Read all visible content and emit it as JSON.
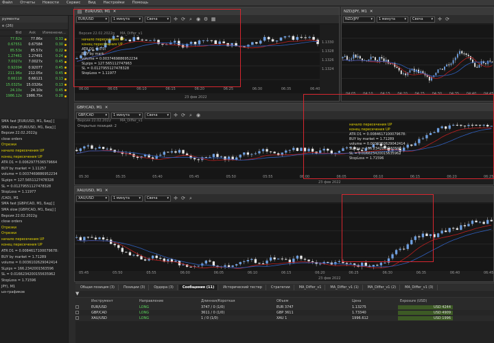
{
  "menu": [
    "Файл",
    "Отчеты",
    "Новости",
    "Сервис",
    "Вид",
    "Настройки",
    "Помощь"
  ],
  "left": {
    "label": "рументы",
    "tabs": [
      "е (26)",
      ""
    ],
    "cols": [
      "",
      "Bid",
      "Ask",
      "Изменени..."
    ],
    "quotes": [
      [
        "77.82x",
        "77.86x",
        "0.33"
      ],
      [
        "0.67551",
        "0.67584",
        "0.30"
      ],
      [
        "85.53x",
        "85.57x",
        "0.22"
      ],
      [
        "1.27461",
        "1.27491",
        "0.24"
      ],
      [
        "7.0027x",
        "7.0027x",
        "0.45"
      ],
      [
        "0.92094",
        "0.92077",
        "0.45"
      ],
      [
        "211.96x",
        "212.05x",
        "0.45"
      ],
      [
        "0.66118",
        "0.66121",
        "0.13"
      ],
      [
        "15.0325x",
        "15.0326x",
        "0.13"
      ],
      [
        "24.10x",
        "24.10x",
        "0.45"
      ],
      [
        "1986.12x",
        "1986.75x",
        "0.28"
      ]
    ],
    "log": [
      "SMA fast [EUR/USD, M1, Бид] [",
      "SMA slow [EUR/USD, M1, Бид] [",
      "Версия 22.02.2022g",
      "close orders",
      "Отрезки",
      "начало пересечения UP",
      "конец пересечения UP",
      "ATR D1 = 0.0062977536579664",
      "BUY by market = 1.11257",
      "volume = 0.0037469886952234",
      "SLpips = 127.5651127478328",
      "SL = 0.01279551127478328",
      "StopLoss = 1.11977",
      "/CAD), M1",
      "SMA fast [GBP/CAD, M1, Бид] [",
      "SMA slow [GBP/CAD, M1, Бид] [",
      "Версия 22.02.2022g",
      "close orders",
      "Отрезки",
      "Отрезки",
      "начало пересечения UP",
      "конец пересечения UP",
      "ATR D1 = 0.0084617100079678:",
      "BUY by market = 1.71289",
      "volume = 0.0036102629042414",
      "SLpips = 166.2342001563596",
      "SL = 0.0166234200155635962",
      "StopLoss = 1.71596",
      "JPY), M1",
      "ыэ-графиков"
    ]
  },
  "windows": [
    {
      "title": "EUR/USD, M1",
      "symbol": "EUR/USD",
      "tf": "1 минута",
      "ctype": "Свеча",
      "axis": [
        "1.1330",
        "1.1328",
        "1.1326",
        "1.1324"
      ],
      "times": [
        "06:00",
        "06:05",
        "06:10",
        "06:15",
        "06:20",
        "06:25",
        "06:30",
        "06:35",
        "06:40"
      ],
      "date": "23 фев 2022",
      "version": "Версия 22.02.2022g",
      "ma": "MA_Differ_v1",
      "ann": [
        "начало пересечения UP",
        "конец пересечения UP",
        "ATR D1 = 0.0",
        "BUY by mark",
        "volume = 0.0037469886952234",
        "SLpips = 127.565112747963",
        "SL = 0.0127955127478328",
        "StopLoss = 1.11977"
      ]
    },
    {
      "title": "NZD/JPY, M1",
      "symbol": "NZD/JPY",
      "tf": "1 минута",
      "ctype": "Свеча",
      "times": [
        "04:05",
        "04:10",
        "04:15",
        "04:20",
        "04:25",
        "04:30",
        "04:35",
        "04:40",
        "04:45"
      ]
    },
    {
      "title": "GBP/CAD, M1",
      "symbol": "GBP/CAD",
      "tf": "1 минута",
      "ctype": "Свеча",
      "times": [
        "05:30",
        "05:35",
        "05:40",
        "05:45",
        "05:50",
        "05:55",
        "06:00",
        "06:05",
        "06:10",
        "06:15",
        "06:20",
        "06:25"
      ],
      "date": "23 фев 2022",
      "version": "Версия 22.02.2022",
      "open": "Открытых позиций: 2",
      "ma": "MA_Differ_v1",
      "ann": [
        "начало пересечения UP",
        "конец пересечения UP",
        "ATR D1 = 0.0084617100079678:",
        "BUY by market = 1.71289",
        "volume = 0.0036102629042414",
        "SLpips = 166.2342001563596",
        "SL = 0.016623420015635962",
        "StopLoss = 1.71596"
      ]
    },
    {
      "title": "XAU/USD, M1",
      "symbol": "XAU/USD",
      "tf": "1 минута",
      "ctype": "Свеча",
      "times": [
        "05:45",
        "05:50",
        "05:55",
        "06:00",
        "06:05",
        "06:10",
        "06:15",
        "06:20",
        "06:25",
        "06:30",
        "06:35",
        "06:40",
        "06:45"
      ],
      "date": "23 фев 2022"
    }
  ],
  "bottom": {
    "tabs": [
      "Общая позиция (3)",
      "Позиции (3)",
      "Ордера (3)",
      "Сообщения (11)",
      "Исторический тестер",
      "Стратегии",
      "MA_Differ_v1",
      "MA_Differ_v1 (1)",
      "MA_Differ_v1 (2)",
      "MA_Differ_v1 (3)"
    ],
    "headers": [
      "Инструмент",
      "Направление",
      "Длинная/Короткая",
      "Объем",
      "Цена",
      "Exposure (USD)"
    ],
    "rows": [
      [
        "EUR/USD",
        "LONG",
        "3747 / 0 (1/0)",
        "EUR 3747",
        "1.13275",
        "USD 4244"
      ],
      [
        "GBP/CAD",
        "LONG",
        "3611 / 0 (1/0)",
        "GBP 3611",
        "1.73340",
        "USD 4909"
      ],
      [
        "XAU/USD",
        "LONG",
        "1 / 0 (1/0)",
        "XAU 1",
        "1996.612",
        "USD 1996"
      ]
    ]
  },
  "colors": {
    "bull": "#6e9fe0",
    "bear": "#e8e8e8",
    "ma": "#c02020",
    "ma2": "#3060c0",
    "red": "#d9262f"
  }
}
